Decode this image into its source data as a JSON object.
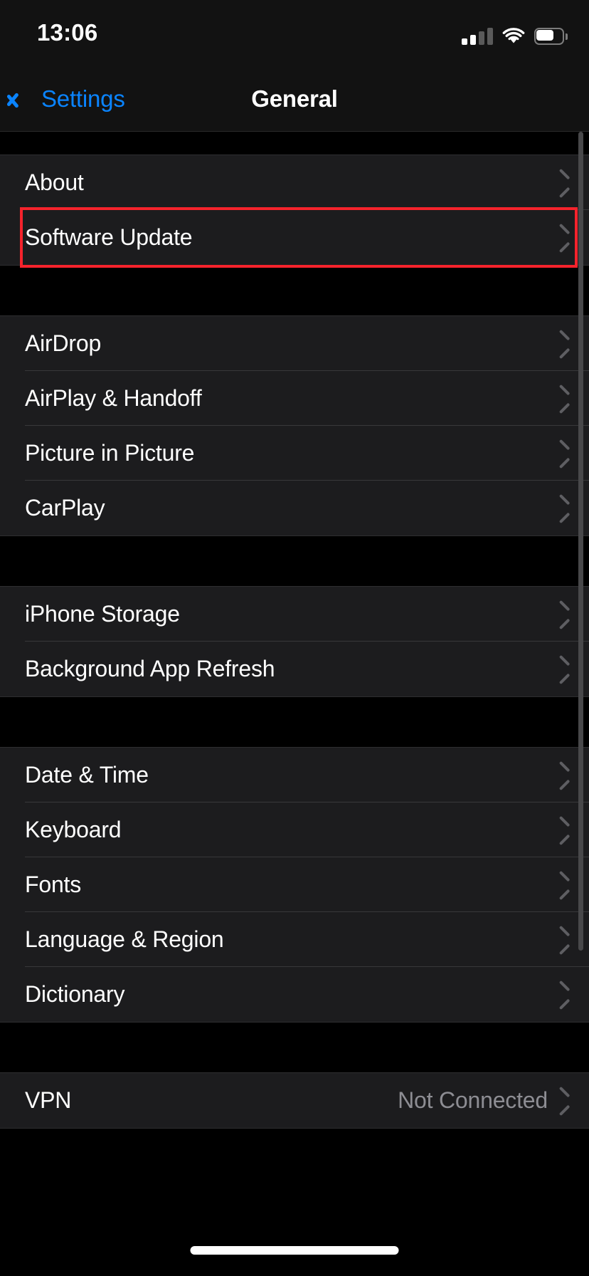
{
  "status_bar": {
    "time": "13:06",
    "cellular_icon": "cellular-signal-icon",
    "cellular_bars_filled": 2,
    "cellular_bars_total": 4,
    "wifi_icon": "wifi-icon",
    "battery_icon": "battery-icon",
    "battery_level_percent": 65
  },
  "nav_bar": {
    "back_label": "Settings",
    "back_icon": "chevron-left-icon",
    "title": "General"
  },
  "colors": {
    "accent_blue": "#0a84ff",
    "highlight_red": "#f5232c",
    "row_background": "#1c1c1e",
    "page_background": "#000000",
    "separator": "#38383a",
    "secondary_text": "#8d8d93"
  },
  "highlight": {
    "target_row": "Software Update",
    "color": "#f5232c"
  },
  "sections": [
    {
      "id": "section-about",
      "rows": [
        {
          "label": "About",
          "value": "",
          "accessory": "chevron-right-icon",
          "highlighted": false
        },
        {
          "label": "Software Update",
          "value": "",
          "accessory": "chevron-right-icon",
          "highlighted": true
        }
      ]
    },
    {
      "id": "section-connectivity",
      "rows": [
        {
          "label": "AirDrop",
          "value": "",
          "accessory": "chevron-right-icon",
          "highlighted": false
        },
        {
          "label": "AirPlay & Handoff",
          "value": "",
          "accessory": "chevron-right-icon",
          "highlighted": false
        },
        {
          "label": "Picture in Picture",
          "value": "",
          "accessory": "chevron-right-icon",
          "highlighted": false
        },
        {
          "label": "CarPlay",
          "value": "",
          "accessory": "chevron-right-icon",
          "highlighted": false
        }
      ]
    },
    {
      "id": "section-storage",
      "rows": [
        {
          "label": "iPhone Storage",
          "value": "",
          "accessory": "chevron-right-icon",
          "highlighted": false
        },
        {
          "label": "Background App Refresh",
          "value": "",
          "accessory": "chevron-right-icon",
          "highlighted": false
        }
      ]
    },
    {
      "id": "section-localization",
      "rows": [
        {
          "label": "Date & Time",
          "value": "",
          "accessory": "chevron-right-icon",
          "highlighted": false
        },
        {
          "label": "Keyboard",
          "value": "",
          "accessory": "chevron-right-icon",
          "highlighted": false
        },
        {
          "label": "Fonts",
          "value": "",
          "accessory": "chevron-right-icon",
          "highlighted": false
        },
        {
          "label": "Language & Region",
          "value": "",
          "accessory": "chevron-right-icon",
          "highlighted": false
        },
        {
          "label": "Dictionary",
          "value": "",
          "accessory": "chevron-right-icon",
          "highlighted": false
        }
      ]
    },
    {
      "id": "section-vpn",
      "rows": [
        {
          "label": "VPN",
          "value": "Not Connected",
          "accessory": "chevron-right-icon",
          "highlighted": false
        }
      ]
    }
  ]
}
